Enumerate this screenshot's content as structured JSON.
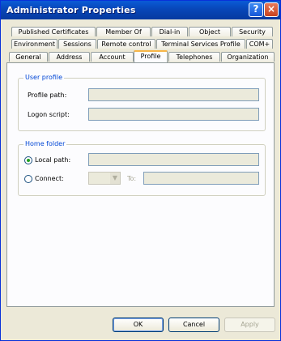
{
  "window": {
    "title": "Administrator Properties",
    "help_glyph": "?",
    "close_glyph": "×"
  },
  "tabs": {
    "row1": [
      "Published Certificates",
      "Member Of",
      "Dial-in",
      "Object",
      "Security"
    ],
    "row2": [
      "Environment",
      "Sessions",
      "Remote control",
      "Terminal Services Profile",
      "COM+"
    ],
    "row3": [
      "General",
      "Address",
      "Account",
      "Profile",
      "Telephones",
      "Organization"
    ],
    "selected": "Profile"
  },
  "user_profile": {
    "group_label": "User profile",
    "profile_path_label": "Profile path:",
    "profile_path_value": "",
    "logon_script_label": "Logon script:",
    "logon_script_value": ""
  },
  "home_folder": {
    "group_label": "Home folder",
    "local_path_label": "Local path:",
    "local_path_value": "",
    "connect_label": "Connect:",
    "to_label": "To:",
    "to_value": "",
    "selected_option": "Local path"
  },
  "buttons": {
    "ok": "OK",
    "cancel": "Cancel",
    "apply": "Apply"
  }
}
